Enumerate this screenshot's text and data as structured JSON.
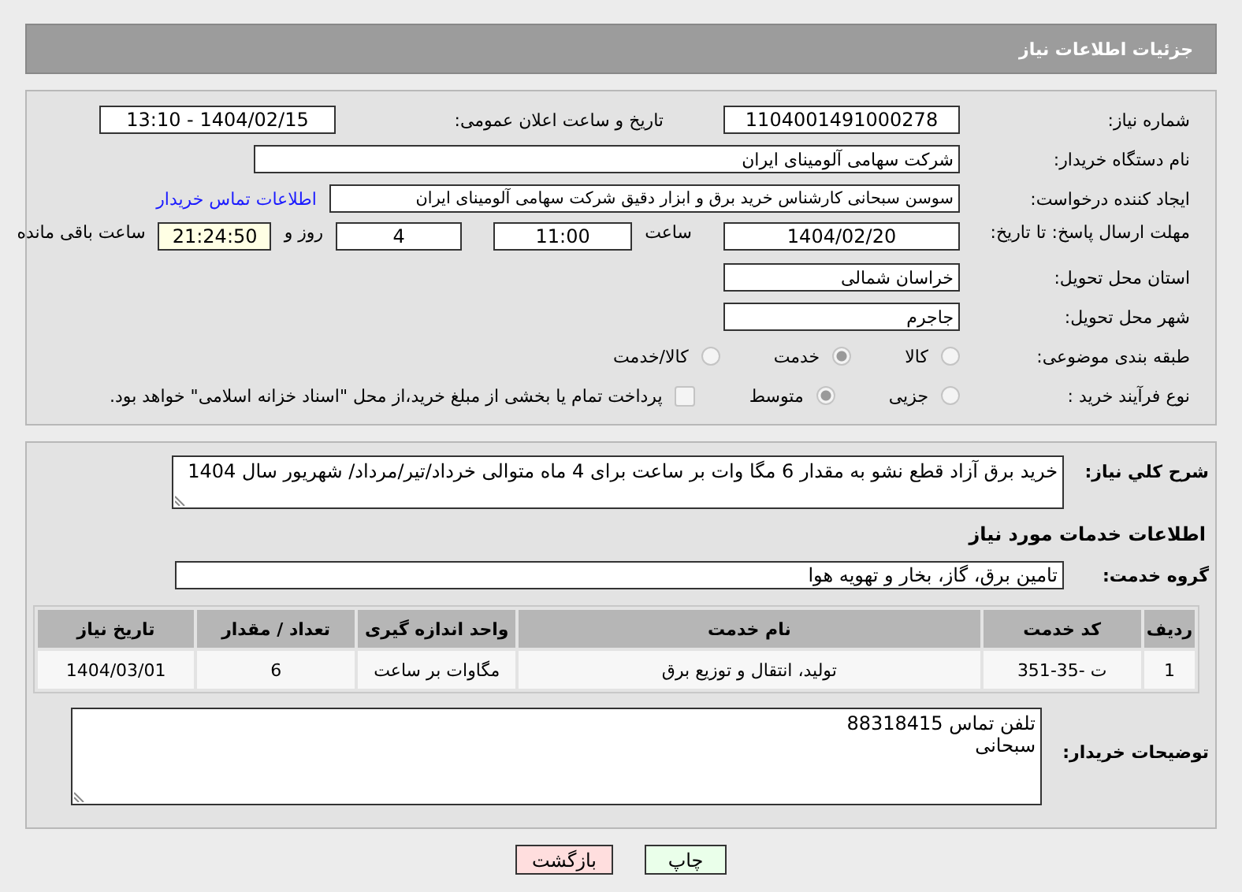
{
  "header": {
    "title": "جزئیات اطلاعات نیاز"
  },
  "details": {
    "need_number": {
      "label": "شماره نیاز:",
      "value": "1104001491000278"
    },
    "announce": {
      "label": "تاریخ و ساعت اعلان عمومی:",
      "value": "1404/02/15 - 13:10"
    },
    "buyer": {
      "label": "نام دستگاه خریدار:",
      "value": "شرکت سهامی آلومینای ایران"
    },
    "creator": {
      "label": "ایجاد کننده درخواست:",
      "value": "سوسن سبحانی کارشناس خرید برق و ابزار دقیق شرکت سهامی آلومینای ایران",
      "link": "اطلاعات تماس خریدار"
    },
    "deadline": {
      "label": "مهلت ارسال پاسخ: تا تاریخ:",
      "date": "1404/02/20",
      "time_label": "ساعت",
      "time": "11:00",
      "days": "4",
      "days_label": "روز و",
      "remaining": "21:24:50",
      "remaining_label": "ساعت باقی مانده"
    },
    "province": {
      "label": "استان محل تحویل:",
      "value": "خراسان شمالی"
    },
    "city": {
      "label": "شهر محل تحویل:",
      "value": "جاجرم"
    },
    "category": {
      "label": "طبقه بندی موضوعی:",
      "options": [
        {
          "label": "کالا",
          "selected": false
        },
        {
          "label": "خدمت",
          "selected": true
        },
        {
          "label": "کالا/خدمت",
          "selected": false
        }
      ]
    },
    "process": {
      "label": "نوع فرآیند خرید :",
      "options": [
        {
          "label": "جزیی",
          "selected": false
        },
        {
          "label": "متوسط",
          "selected": true
        }
      ],
      "treasury": {
        "label": "پرداخت تمام یا بخشی از مبلغ خرید،از محل \"اسناد خزانه اسلامی\" خواهد بود.",
        "checked": false
      }
    }
  },
  "services": {
    "description": {
      "label": "شرح کلي نياز:",
      "value": "خرید برق آزاد قطع نشو به مقدار 6 مگا وات بر ساعت برای 4 ماه متوالی خرداد/تیر/مرداد/ شهریور سال 1404"
    },
    "heading": "اطلاعات خدمات مورد نیاز",
    "group": {
      "label": "گروه خدمت:",
      "value": "تامین برق، گاز، بخار و تهویه هوا"
    },
    "table": {
      "columns": [
        "ردیف",
        "کد خدمت",
        "نام خدمت",
        "واحد اندازه گیری",
        "تعداد / مقدار",
        "تاریخ نیاز"
      ],
      "rows": [
        [
          "1",
          "ت -35-351",
          "تولید، انتقال و توزیع برق",
          "مگاوات بر ساعت",
          "6",
          "1404/03/01"
        ]
      ]
    },
    "notes": {
      "label": "توضیحات خریدار:",
      "lines": [
        "تلفن تماس 88318415",
        "سبحانی"
      ]
    }
  },
  "buttons": [
    {
      "label": "چاپ",
      "kind": "print"
    },
    {
      "label": "بازگشت",
      "kind": "back"
    }
  ]
}
